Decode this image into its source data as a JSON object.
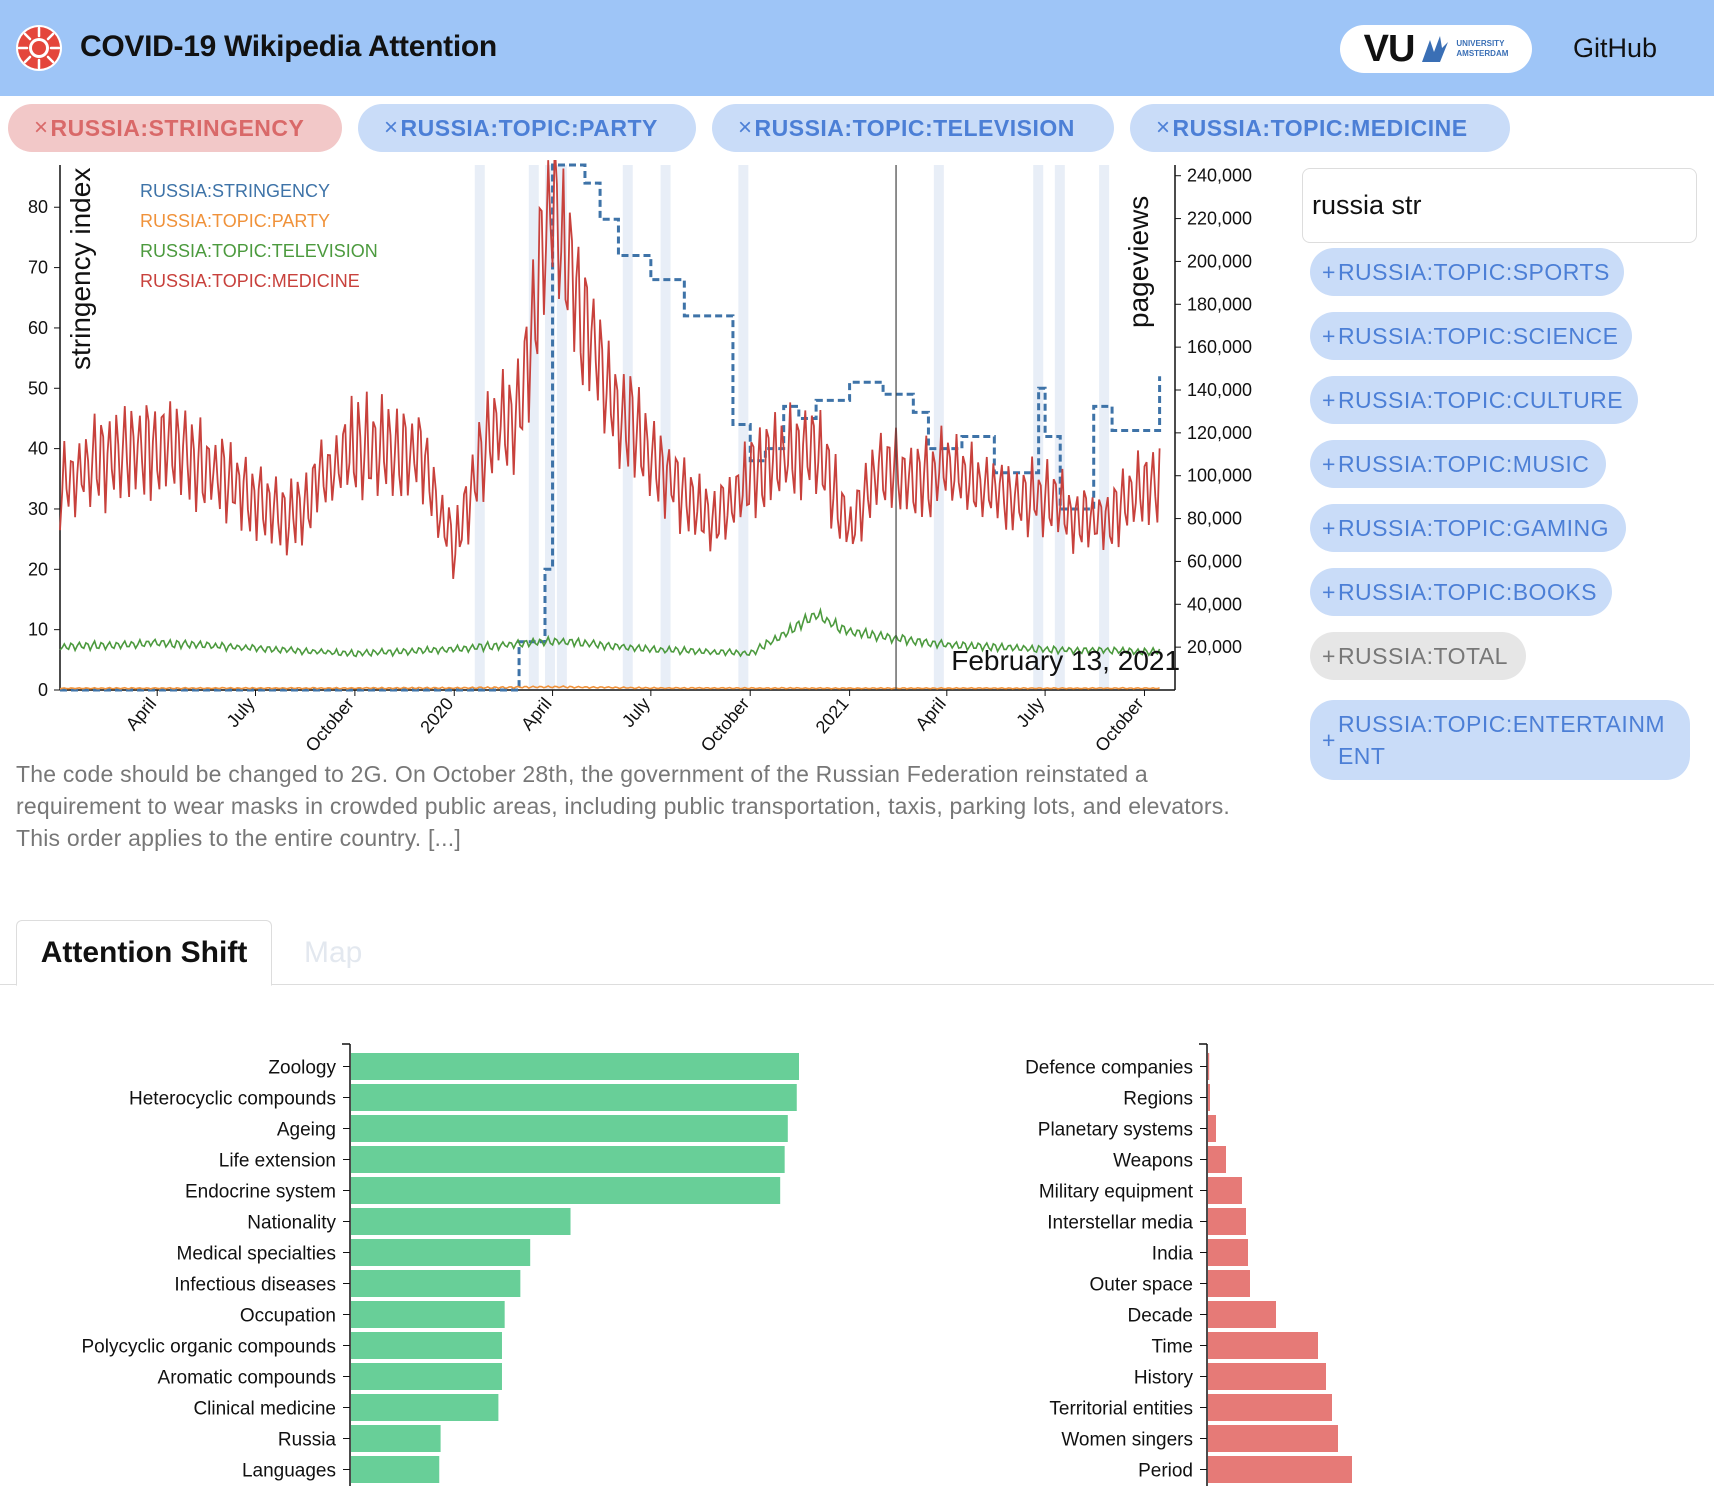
{
  "app": {
    "title": "COVID-19 Wikipedia Attention",
    "brand_logo_text": "VU",
    "brand_sub1": "UNIVERSITY",
    "brand_sub2": "AMSTERDAM",
    "github_label": "GitHub",
    "header_color": "#9ec5f7"
  },
  "selected_chips": [
    {
      "label": "RUSSIA:STRINGENCY",
      "remove_glyph": "×",
      "color": "#d96969"
    },
    {
      "label": "RUSSIA:TOPIC:PARTY",
      "remove_glyph": "×",
      "color": "#4c7fd6"
    },
    {
      "label": "RUSSIA:TOPIC:TELEVISION",
      "remove_glyph": "×",
      "color": "#4c7fd6"
    },
    {
      "label": "RUSSIA:TOPIC:MEDICINE",
      "remove_glyph": "×",
      "color": "#4c7fd6"
    }
  ],
  "search": {
    "value": "russia str"
  },
  "suggestions": [
    {
      "label": "RUSSIA:TOPIC:SPORTS",
      "add_glyph": "+"
    },
    {
      "label": "RUSSIA:TOPIC:SCIENCE",
      "add_glyph": "+"
    },
    {
      "label": "RUSSIA:TOPIC:CULTURE",
      "add_glyph": "+"
    },
    {
      "label": "RUSSIA:TOPIC:MUSIC",
      "add_glyph": "+"
    },
    {
      "label": "RUSSIA:TOPIC:GAMING",
      "add_glyph": "+"
    },
    {
      "label": "RUSSIA:TOPIC:BOOKS",
      "add_glyph": "+"
    },
    {
      "label": "RUSSIA:TOTAL",
      "add_glyph": "+"
    },
    {
      "label": "RUSSIA:TOPIC:ENTERTAINMENT",
      "add_glyph": "+"
    }
  ],
  "description": "The code should be changed to 2G. On October 28th, the government of the Russian Federation reinstated a requirement to wear masks in crowded public areas, including public transportation, taxis, parking lots, and elevators. This order applies to the entire country. [...]",
  "tabs": {
    "active": "Attention Shift",
    "inactive": "Map"
  },
  "chart_data": [
    {
      "type": "line",
      "title": "",
      "ylabel_left": "stringency index",
      "ylabel_right": "pageviews",
      "y_left_ticks": [
        "0",
        "10",
        "20",
        "30",
        "40",
        "50",
        "60",
        "70",
        "80"
      ],
      "y_right_ticks": [
        "20,000",
        "40,000",
        "60,000",
        "80,000",
        "100,000",
        "120,000",
        "140,000",
        "160,000",
        "180,000",
        "200,000",
        "220,000",
        "240,000"
      ],
      "x_ticks": [
        "April",
        "July",
        "October",
        "2020",
        "April",
        "July",
        "October",
        "2021",
        "April",
        "July",
        "October"
      ],
      "ylim_left": [
        0,
        87
      ],
      "ylim_right": [
        0,
        245000
      ],
      "cursor_date": "February 13, 2021",
      "grid": false,
      "legend_position": "top-left",
      "series": [
        {
          "name": "RUSSIA:STRINGENCY",
          "color": "#3e73a8",
          "axis": "left",
          "style": "dashed",
          "x": [
            "2019-01",
            "2020-02",
            "2020-03-01",
            "2020-03-15",
            "2020-03-25",
            "2020-04-01",
            "2020-05-01",
            "2020-05-15",
            "2020-06-01",
            "2020-07-01",
            "2020-08-01",
            "2020-09-15",
            "2020-10-01",
            "2020-10-15",
            "2020-11-01",
            "2020-11-15",
            "2020-12-01",
            "2021-01-01",
            "2021-02-01",
            "2021-03-01",
            "2021-03-15",
            "2021-04-15",
            "2021-05-15",
            "2021-06-15",
            "2021-06-25",
            "2021-07-01",
            "2021-07-15",
            "2021-08-15",
            "2021-09-01",
            "2021-10-15"
          ],
          "values": [
            0,
            0,
            8,
            8,
            20,
            87,
            84,
            78,
            72,
            68,
            62,
            44,
            38,
            40,
            47,
            45,
            48,
            51,
            49,
            46,
            40,
            42,
            36,
            36,
            50,
            42,
            30,
            47,
            43,
            52
          ]
        },
        {
          "name": "RUSSIA:TOPIC:PARTY",
          "color": "#f0923a",
          "axis": "right",
          "x": [
            "2019-01",
            "2020-01",
            "2020-04",
            "2020-07",
            "2021-01",
            "2021-10"
          ],
          "values": [
            800,
            900,
            1500,
            900,
            800,
            800
          ]
        },
        {
          "name": "RUSSIA:TOPIC:TELEVISION",
          "color": "#4c9a3e",
          "axis": "right",
          "x": [
            "2019-01",
            "2019-04",
            "2019-10",
            "2020-01",
            "2020-04",
            "2020-07",
            "2020-10",
            "2020-12",
            "2021-01",
            "2021-04",
            "2021-07",
            "2021-10"
          ],
          "values": [
            20000,
            22000,
            17000,
            19000,
            23000,
            19000,
            17000,
            35000,
            27000,
            21000,
            19000,
            18000
          ]
        },
        {
          "name": "RUSSIA:TOPIC:MEDICINE",
          "color": "#c8413c",
          "axis": "right",
          "x": [
            "2019-01",
            "2019-02",
            "2019-04",
            "2019-06",
            "2019-08",
            "2019-10",
            "2019-12",
            "2020-01",
            "2020-02",
            "2020-03",
            "2020-04",
            "2020-05",
            "2020-06",
            "2020-07",
            "2020-08",
            "2020-09",
            "2020-10",
            "2020-11",
            "2020-12",
            "2021-01",
            "2021-02",
            "2021-03",
            "2021-04",
            "2021-05",
            "2021-06",
            "2021-07",
            "2021-08",
            "2021-09",
            "2021-10"
          ],
          "values": [
            95000,
            105000,
            115000,
            100000,
            80000,
            115000,
            110000,
            65000,
            120000,
            130000,
            230000,
            170000,
            130000,
            110000,
            90000,
            80000,
            100000,
            110000,
            115000,
            75000,
            105000,
            95000,
            105000,
            95000,
            90000,
            90000,
            80000,
            80000,
            95000
          ]
        }
      ]
    },
    {
      "type": "bar",
      "orientation": "horizontal",
      "color": "#68cf98",
      "categories": [
        "Zoology",
        "Heterocyclic compounds",
        "Ageing",
        "Life extension",
        "Endocrine system",
        "Nationality",
        "Medical specialties",
        "Infectious diseases",
        "Occupation",
        "Polycyclic organic compounds",
        "Aromatic compounds",
        "Clinical medicine",
        "Russia",
        "Languages"
      ],
      "values": [
        1.0,
        0.995,
        0.975,
        0.968,
        0.958,
        0.49,
        0.4,
        0.378,
        0.343,
        0.337,
        0.337,
        0.329,
        0.2,
        0.197
      ]
    },
    {
      "type": "bar",
      "orientation": "horizontal",
      "color": "#e67a77",
      "categories": [
        "Defence companies",
        "Regions",
        "Planetary systems",
        "Weapons",
        "Military equipment",
        "Interstellar media",
        "India",
        "Outer space",
        "Decade",
        "Time",
        "History",
        "Territorial entities",
        "Women singers",
        "Period"
      ],
      "values": [
        0.003,
        0.005,
        0.02,
        0.045,
        0.085,
        0.095,
        0.1,
        0.105,
        0.17,
        0.275,
        0.295,
        0.31,
        0.325,
        0.36
      ]
    }
  ]
}
